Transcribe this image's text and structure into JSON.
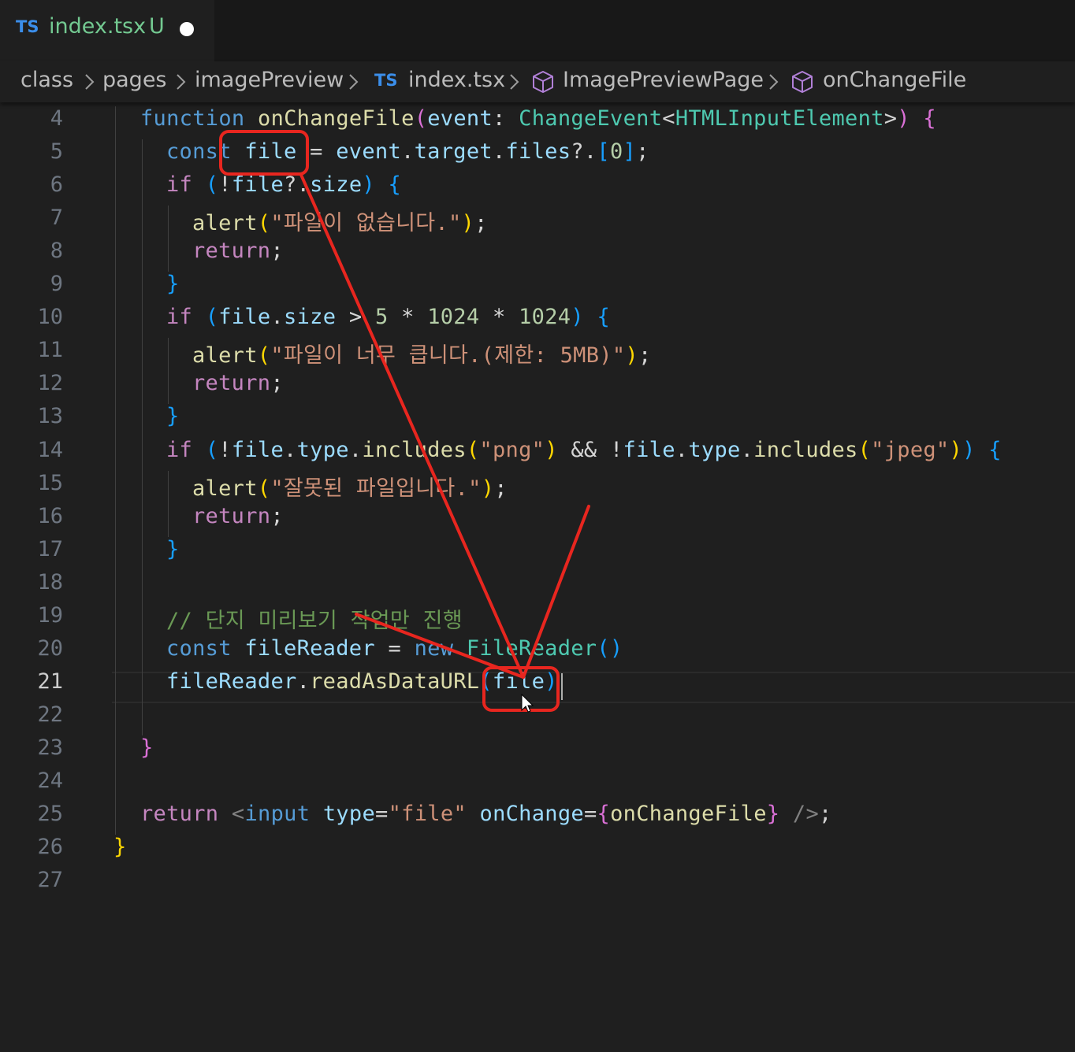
{
  "tab": {
    "lang": "TS",
    "filename": "index.tsx",
    "status": "U"
  },
  "breadcrumb": {
    "items": [
      {
        "label": "class"
      },
      {
        "label": "pages"
      },
      {
        "label": "imagePreview"
      },
      {
        "label": "index.tsx",
        "lang": "TS"
      },
      {
        "label": "ImagePreviewPage",
        "icon": "cube-icon"
      },
      {
        "label": "onChangeFile",
        "icon": "cube-icon"
      }
    ]
  },
  "editor": {
    "active_line": 21,
    "line_numbers": [
      "4",
      "5",
      "6",
      "7",
      "8",
      "9",
      "10",
      "11",
      "12",
      "13",
      "14",
      "15",
      "16",
      "17",
      "18",
      "19",
      "20",
      "21",
      "22",
      "23",
      "24",
      "25",
      "26",
      "27"
    ],
    "lines": [
      {
        "n": 4,
        "indent": 1,
        "tokens": [
          [
            "kw",
            "function"
          ],
          [
            "pun",
            " "
          ],
          [
            "fn",
            "onChangeFile"
          ],
          [
            "br2",
            "("
          ],
          [
            "var",
            "event"
          ],
          [
            "pun",
            ": "
          ],
          [
            "type",
            "ChangeEvent"
          ],
          [
            "pun",
            "<"
          ],
          [
            "type",
            "HTMLInputElement"
          ],
          [
            "pun",
            ">"
          ],
          [
            "br2",
            ")"
          ],
          [
            "pun",
            " "
          ],
          [
            "br2",
            "{"
          ]
        ]
      },
      {
        "n": 5,
        "indent": 2,
        "tokens": [
          [
            "kw",
            "const"
          ],
          [
            "pun",
            " "
          ],
          [
            "var",
            "file"
          ],
          [
            "pun",
            " = "
          ],
          [
            "var",
            "event"
          ],
          [
            "pun",
            "."
          ],
          [
            "var",
            "target"
          ],
          [
            "pun",
            "."
          ],
          [
            "var",
            "files"
          ],
          [
            "pun",
            "?."
          ],
          [
            "br3",
            "["
          ],
          [
            "num",
            "0"
          ],
          [
            "br3",
            "]"
          ],
          [
            "pun",
            ";"
          ]
        ]
      },
      {
        "n": 6,
        "indent": 2,
        "tokens": [
          [
            "ctl",
            "if"
          ],
          [
            "pun",
            " "
          ],
          [
            "br3",
            "("
          ],
          [
            "pun",
            "!"
          ],
          [
            "var",
            "file"
          ],
          [
            "pun",
            "?."
          ],
          [
            "var",
            "size"
          ],
          [
            "br3",
            ")"
          ],
          [
            "pun",
            " "
          ],
          [
            "br3",
            "{"
          ]
        ]
      },
      {
        "n": 7,
        "indent": 3,
        "tokens": [
          [
            "fn",
            "alert"
          ],
          [
            "br1",
            "("
          ],
          [
            "str",
            "\"파일이 없습니다.\""
          ],
          [
            "br1",
            ")"
          ],
          [
            "pun",
            ";"
          ]
        ]
      },
      {
        "n": 8,
        "indent": 3,
        "tokens": [
          [
            "ctl",
            "return"
          ],
          [
            "pun",
            ";"
          ]
        ]
      },
      {
        "n": 9,
        "indent": 2,
        "tokens": [
          [
            "br3",
            "}"
          ]
        ]
      },
      {
        "n": 10,
        "indent": 2,
        "tokens": [
          [
            "ctl",
            "if"
          ],
          [
            "pun",
            " "
          ],
          [
            "br3",
            "("
          ],
          [
            "var",
            "file"
          ],
          [
            "pun",
            "."
          ],
          [
            "var",
            "size"
          ],
          [
            "pun",
            " > "
          ],
          [
            "num",
            "5"
          ],
          [
            "pun",
            " * "
          ],
          [
            "num",
            "1024"
          ],
          [
            "pun",
            " * "
          ],
          [
            "num",
            "1024"
          ],
          [
            "br3",
            ")"
          ],
          [
            "pun",
            " "
          ],
          [
            "br3",
            "{"
          ]
        ]
      },
      {
        "n": 11,
        "indent": 3,
        "tokens": [
          [
            "fn",
            "alert"
          ],
          [
            "br1",
            "("
          ],
          [
            "str",
            "\"파일이 너무 큽니다.(제한: 5MB)\""
          ],
          [
            "br1",
            ")"
          ],
          [
            "pun",
            ";"
          ]
        ]
      },
      {
        "n": 12,
        "indent": 3,
        "tokens": [
          [
            "ctl",
            "return"
          ],
          [
            "pun",
            ";"
          ]
        ]
      },
      {
        "n": 13,
        "indent": 2,
        "tokens": [
          [
            "br3",
            "}"
          ]
        ]
      },
      {
        "n": 14,
        "indent": 2,
        "tokens": [
          [
            "ctl",
            "if"
          ],
          [
            "pun",
            " "
          ],
          [
            "br3",
            "("
          ],
          [
            "pun",
            "!"
          ],
          [
            "var",
            "file"
          ],
          [
            "pun",
            "."
          ],
          [
            "var",
            "type"
          ],
          [
            "pun",
            "."
          ],
          [
            "fn",
            "includes"
          ],
          [
            "br1",
            "("
          ],
          [
            "str",
            "\"png\""
          ],
          [
            "br1",
            ")"
          ],
          [
            "pun",
            " && !"
          ],
          [
            "var",
            "file"
          ],
          [
            "pun",
            "."
          ],
          [
            "var",
            "type"
          ],
          [
            "pun",
            "."
          ],
          [
            "fn",
            "includes"
          ],
          [
            "br1",
            "("
          ],
          [
            "str",
            "\"jpeg\""
          ],
          [
            "br1",
            ")"
          ],
          [
            "br3",
            ")"
          ],
          [
            "pun",
            " "
          ],
          [
            "br3",
            "{"
          ]
        ]
      },
      {
        "n": 15,
        "indent": 3,
        "tokens": [
          [
            "fn",
            "alert"
          ],
          [
            "br1",
            "("
          ],
          [
            "str",
            "\"잘못된 파일입니다.\""
          ],
          [
            "br1",
            ")"
          ],
          [
            "pun",
            ";"
          ]
        ]
      },
      {
        "n": 16,
        "indent": 3,
        "tokens": [
          [
            "ctl",
            "return"
          ],
          [
            "pun",
            ";"
          ]
        ]
      },
      {
        "n": 17,
        "indent": 2,
        "tokens": [
          [
            "br3",
            "}"
          ]
        ]
      },
      {
        "n": 18,
        "indent": 0,
        "tokens": []
      },
      {
        "n": 19,
        "indent": 2,
        "tokens": [
          [
            "cm",
            "// 단지 미리보기 작업만 진행"
          ]
        ]
      },
      {
        "n": 20,
        "indent": 2,
        "tokens": [
          [
            "kw",
            "const"
          ],
          [
            "pun",
            " "
          ],
          [
            "var",
            "fileReader"
          ],
          [
            "pun",
            " = "
          ],
          [
            "kw",
            "new"
          ],
          [
            "pun",
            " "
          ],
          [
            "type",
            "FileReader"
          ],
          [
            "br3",
            "()"
          ]
        ]
      },
      {
        "n": 21,
        "indent": 2,
        "tokens": [
          [
            "var",
            "fileReader"
          ],
          [
            "pun",
            "."
          ],
          [
            "fn",
            "readAsDataURL"
          ],
          [
            "br3",
            "("
          ],
          [
            "var",
            "file"
          ],
          [
            "br3",
            ")"
          ]
        ]
      },
      {
        "n": 22,
        "indent": 0,
        "tokens": []
      },
      {
        "n": 23,
        "indent": 1,
        "tokens": [
          [
            "br2",
            "}"
          ]
        ]
      },
      {
        "n": 24,
        "indent": 0,
        "tokens": []
      },
      {
        "n": 25,
        "indent": 1,
        "tokens": [
          [
            "ctl",
            "return"
          ],
          [
            "pun",
            " "
          ],
          [
            "tag",
            "<"
          ],
          [
            "tagname",
            "input"
          ],
          [
            "pun",
            " "
          ],
          [
            "attr",
            "type"
          ],
          [
            "pun",
            "="
          ],
          [
            "str",
            "\"file\""
          ],
          [
            "pun",
            " "
          ],
          [
            "attr",
            "onChange"
          ],
          [
            "pun",
            "="
          ],
          [
            "br2",
            "{"
          ],
          [
            "fn",
            "onChangeFile"
          ],
          [
            "br2",
            "}"
          ],
          [
            "pun",
            " "
          ],
          [
            "tag",
            "/>"
          ],
          [
            "pun",
            ";"
          ]
        ]
      },
      {
        "n": 26,
        "indent": 0,
        "tokens": [
          [
            "br1",
            "}"
          ]
        ]
      },
      {
        "n": 27,
        "indent": 0,
        "tokens": []
      }
    ]
  },
  "colors": {
    "background": "#1f1f1f",
    "annotation": "#e8261f",
    "modified_tab": "#73c991",
    "ts_icon": "#3b8eea"
  }
}
